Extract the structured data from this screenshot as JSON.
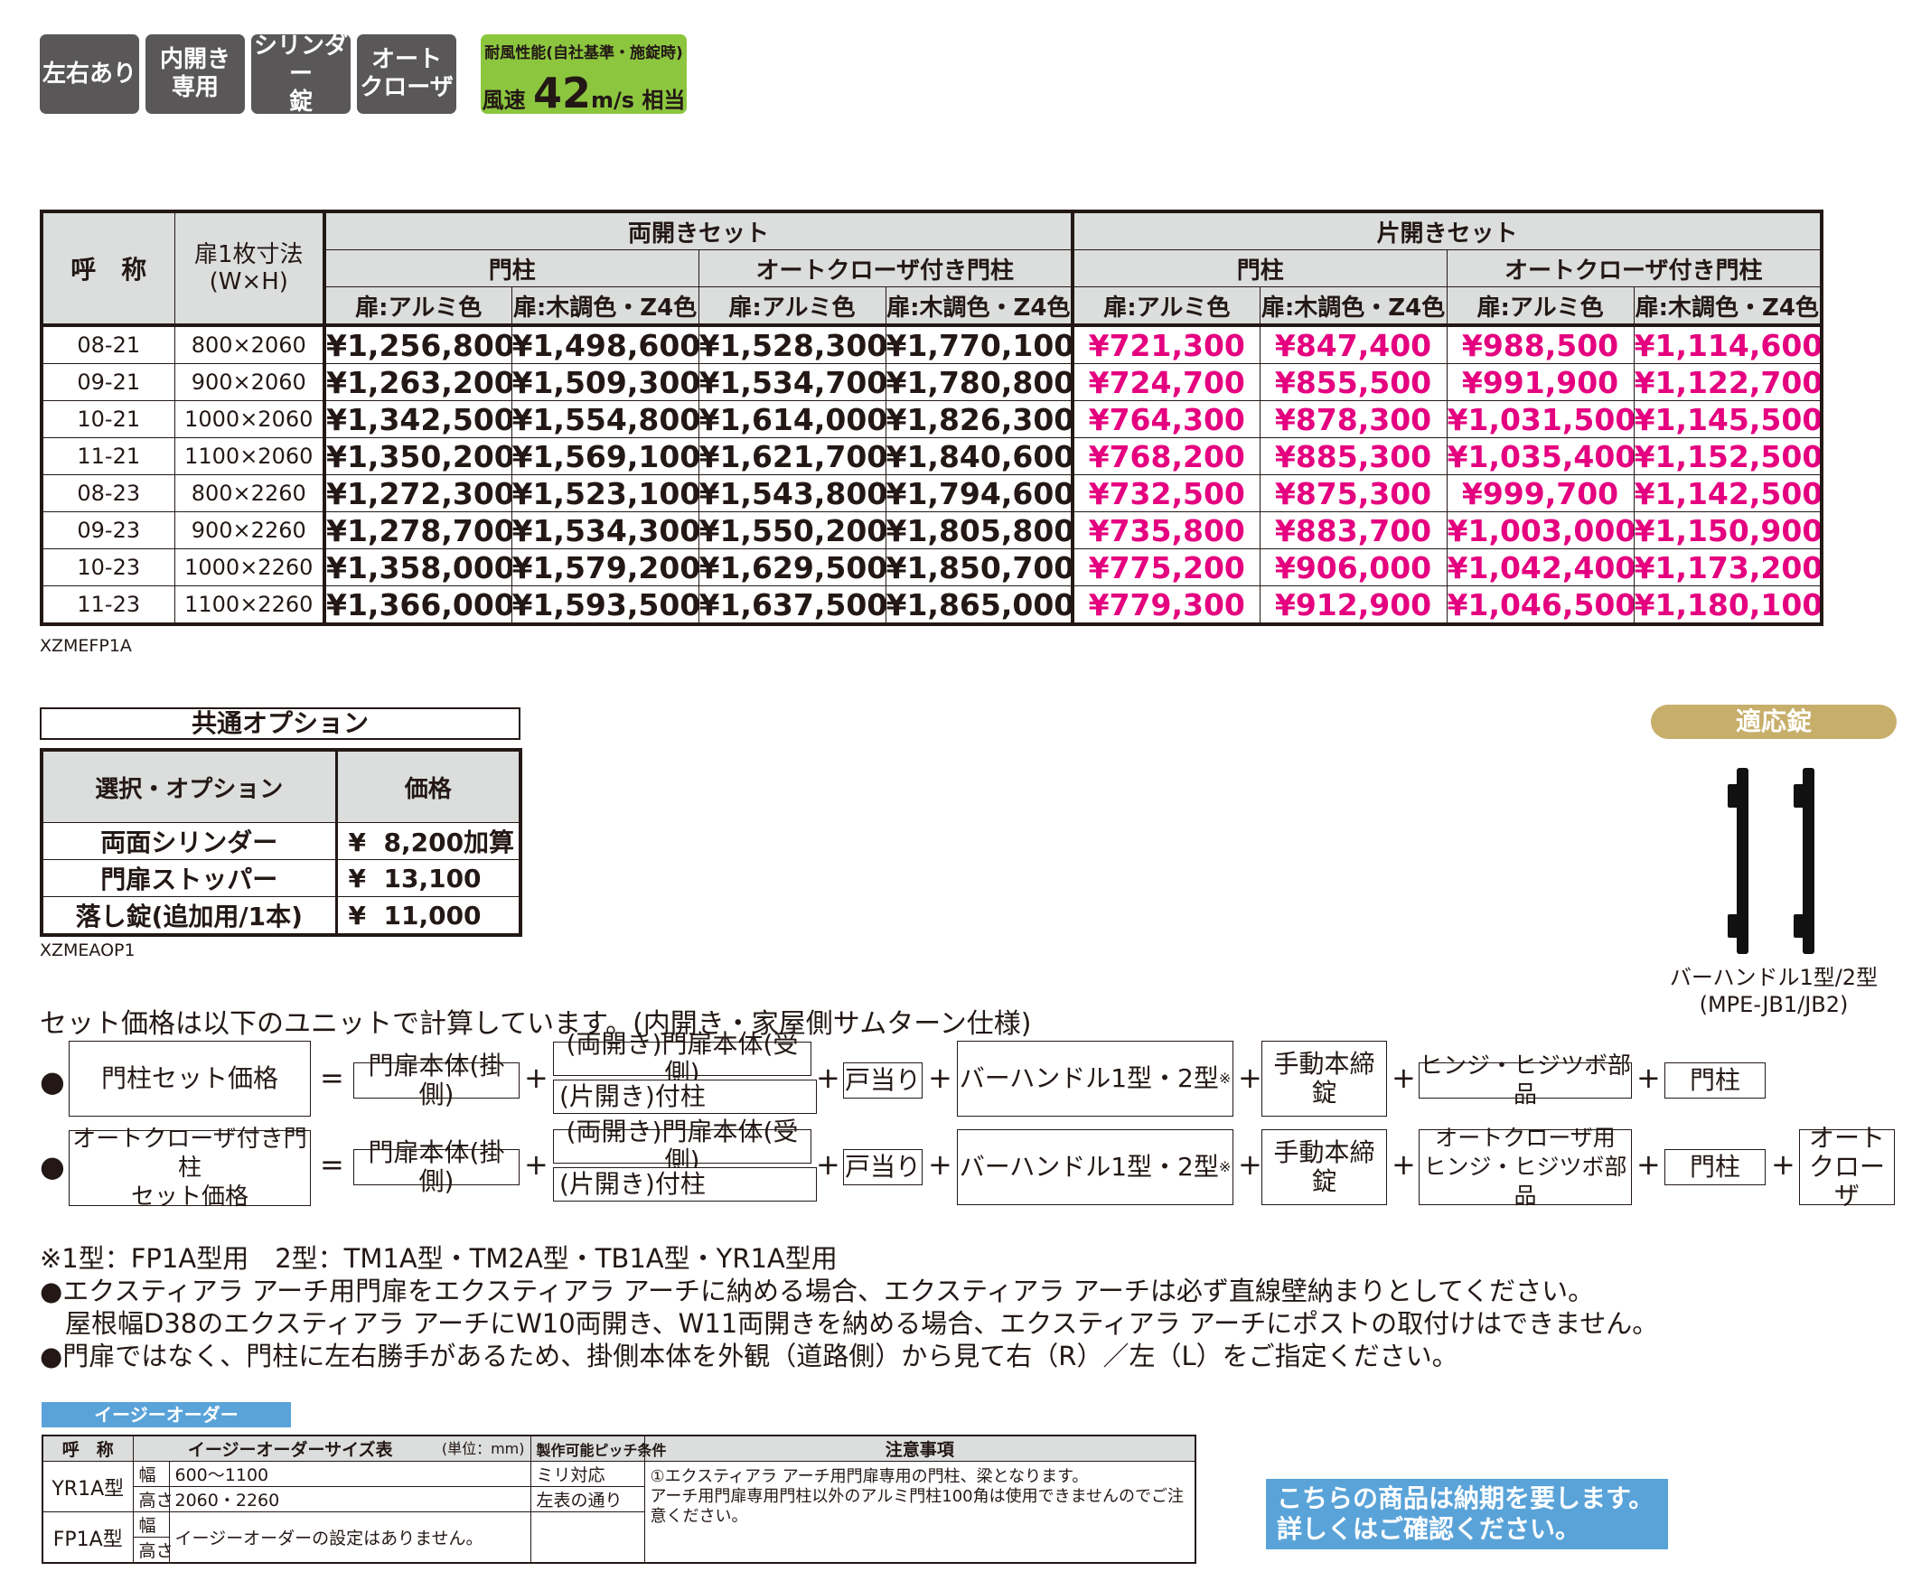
{
  "badges": [
    "左右あり",
    "内開き\n専用",
    "シリンダー\n錠",
    "オート\nクローザ"
  ],
  "wind": {
    "line1": "耐風性能(自社基準・施錠時)",
    "prefix": "風速",
    "value": "42",
    "unit": "m/s",
    "suffix": "相当"
  },
  "main_table": {
    "h_name": "呼　称",
    "h_size": "扉1枚寸法\n(W×H)",
    "h_double": "両開きセット",
    "h_single": "片開きセット",
    "h_post": "門柱",
    "h_ac": "オートクローザ付き門柱",
    "h_alu": "扉:アルミ色",
    "h_wood": "扉:木調色・Z4色",
    "rows": [
      {
        "name": "08-21",
        "size": "800×2060",
        "d1": "¥1,256,800",
        "d2": "¥1,498,600",
        "d3": "¥1,528,300",
        "d4": "¥1,770,100",
        "s1": "¥721,300",
        "s2": "¥847,400",
        "s3": "¥988,500",
        "s4": "¥1,114,600"
      },
      {
        "name": "09-21",
        "size": "900×2060",
        "d1": "¥1,263,200",
        "d2": "¥1,509,300",
        "d3": "¥1,534,700",
        "d4": "¥1,780,800",
        "s1": "¥724,700",
        "s2": "¥855,500",
        "s3": "¥991,900",
        "s4": "¥1,122,700"
      },
      {
        "name": "10-21",
        "size": "1000×2060",
        "d1": "¥1,342,500",
        "d2": "¥1,554,800",
        "d3": "¥1,614,000",
        "d4": "¥1,826,300",
        "s1": "¥764,300",
        "s2": "¥878,300",
        "s3": "¥1,031,500",
        "s4": "¥1,145,500"
      },
      {
        "name": "11-21",
        "size": "1100×2060",
        "d1": "¥1,350,200",
        "d2": "¥1,569,100",
        "d3": "¥1,621,700",
        "d4": "¥1,840,600",
        "s1": "¥768,200",
        "s2": "¥885,300",
        "s3": "¥1,035,400",
        "s4": "¥1,152,500"
      },
      {
        "name": "08-23",
        "size": "800×2260",
        "d1": "¥1,272,300",
        "d2": "¥1,523,100",
        "d3": "¥1,543,800",
        "d4": "¥1,794,600",
        "s1": "¥732,500",
        "s2": "¥875,300",
        "s3": "¥999,700",
        "s4": "¥1,142,500"
      },
      {
        "name": "09-23",
        "size": "900×2260",
        "d1": "¥1,278,700",
        "d2": "¥1,534,300",
        "d3": "¥1,550,200",
        "d4": "¥1,805,800",
        "s1": "¥735,800",
        "s2": "¥883,700",
        "s3": "¥1,003,000",
        "s4": "¥1,150,900"
      },
      {
        "name": "10-23",
        "size": "1000×2260",
        "d1": "¥1,358,000",
        "d2": "¥1,579,200",
        "d3": "¥1,629,500",
        "d4": "¥1,850,700",
        "s1": "¥775,200",
        "s2": "¥906,000",
        "s3": "¥1,042,400",
        "s4": "¥1,173,200"
      },
      {
        "name": "11-23",
        "size": "1100×2260",
        "d1": "¥1,366,000",
        "d2": "¥1,593,500",
        "d3": "¥1,637,500",
        "d4": "¥1,865,000",
        "s1": "¥779,300",
        "s2": "¥912,900",
        "s3": "¥1,046,500",
        "s4": "¥1,180,100"
      }
    ],
    "code": "XZMEFP1A"
  },
  "options": {
    "title": "共通オプション",
    "h_option": "選択・オプション",
    "h_price": "価格",
    "rows": [
      {
        "name": "両面シリンダー",
        "yen": "¥",
        "price": "8,200加算"
      },
      {
        "name": "門扉ストッパー",
        "yen": "¥",
        "price": "13,100"
      },
      {
        "name": "落し錠(追加用/1本)",
        "yen": "¥",
        "price": "11,000"
      }
    ],
    "code": "XZMEAOP1"
  },
  "lock": {
    "title": "適応錠",
    "caption": "バーハンドル1型/2型\n(MPE-JB1/JB2)"
  },
  "formula": {
    "desc": "セット価格は以下のユニットで計算しています。(内開き・家屋側サムターン仕様)",
    "dot": "●",
    "plus": "+",
    "eq": "=",
    "f1_label": "門柱セット価格",
    "f2_label": "オートクローザ付き門柱\nセット価格",
    "gate_body": "門扉本体(掛側)",
    "recv": "(両開き)門扉本体(受側)",
    "post_sub": "(片開き)付柱",
    "stopper": "戸当り",
    "handle": "バーハンドル1型・2型",
    "handle_mark": "※",
    "manual_lock": "手動本締錠",
    "hinge": "ヒンジ・ヒジツボ部品",
    "ac_hinge": "オートクローザ用\nヒンジ・ヒジツボ部品",
    "post": "門柱",
    "closer": "オート\nクローザ"
  },
  "notes": [
    "※1型：FP1A型用　2型：TM1A型・TM2A型・TB1A型・YR1A型用",
    "●エクスティアラ アーチ用門扉をエクスティアラ アーチに納める場合、エクスティアラ アーチは必ず直線壁納まりとしてください。",
    "屋根幅D38のエクスティアラ アーチにW10両開き、W11両開きを納める場合、エクスティアラ アーチにポストの取付けはできません。",
    "●門扉ではなく、門柱に左右勝手があるため、掛側本体を外観（道路側）から見て右（R）／左（L）をご指定ください。"
  ],
  "easy_order": {
    "title": "イージーオーダー",
    "h_name": "呼　称",
    "h_size": "イージーオーダーサイズ表",
    "h_unit": "(単位：mm)",
    "h_pitch": "製作可能ピッチ条件",
    "h_note": "注意事項",
    "yr_name": "YR1A型",
    "fp_name": "FP1A型",
    "w": "幅",
    "h": "高さ",
    "yr_w": "600～1100",
    "yr_h": "2060・2260",
    "yr_pitch1": "ミリ対応",
    "yr_pitch2": "左表の通り",
    "fp_text": "イージーオーダーの設定はありません。",
    "note": "①エクスティアラ アーチ用門扉専用の門柱、梁となります。\nアーチ用門扉専用門柱以外のアルミ門柱100角は使用できませんのでご注意ください。"
  },
  "notice": "こちらの商品は納期を要します。\n詳しくはご確認ください。"
}
